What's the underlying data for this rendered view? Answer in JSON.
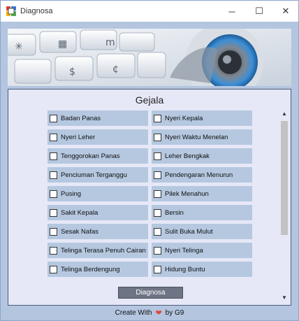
{
  "window": {
    "title": "Diagnosa",
    "minimize": "─",
    "maximize": "☐",
    "close": "✕"
  },
  "panel": {
    "title": "Gejala"
  },
  "symptoms_left": [
    "Badan Panas",
    "Nyeri Leher",
    "Tenggorokan Panas",
    "Penciuman Terganggu",
    "Pusing",
    "Sakit Kepala",
    "Sesak Nafas",
    "Telinga Terasa Penuh Cairan",
    "Telinga Berdengung"
  ],
  "symptoms_right": [
    "Nyeri Kepala",
    "Nyeri Waktu Menelan",
    "Leher Bengkak",
    "Pendengaran Menurun",
    "Pilek Menahun",
    "Bersin",
    "Sulit Buka Mulut",
    "Nyeri Telinga",
    "Hidung Buntu"
  ],
  "button": {
    "diagnosa": "Diagnosa"
  },
  "footer": {
    "prefix": "Create With",
    "suffix": "by G9"
  },
  "scroll": {
    "up": "▲",
    "down": "▼"
  }
}
